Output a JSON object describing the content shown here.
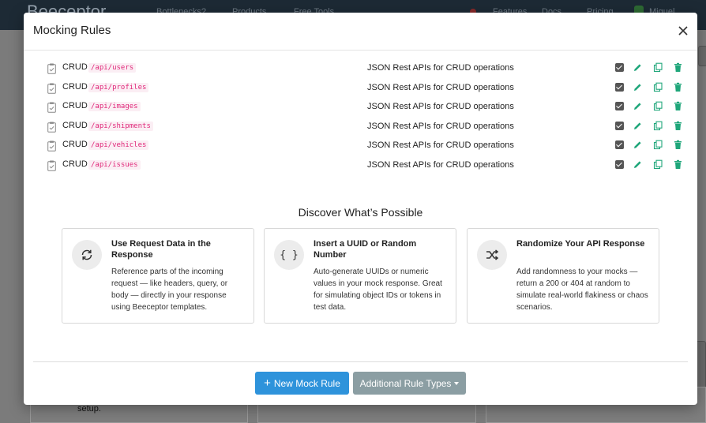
{
  "background": {
    "brand": "Beeceptor",
    "nav": [
      "Bottlenecks?",
      "Products",
      "Free Tools",
      "Features",
      "Docs",
      "Pricing",
      "Miguel"
    ],
    "setup_text": "setup."
  },
  "modal": {
    "title": "Mocking Rules",
    "close_icon": "close-icon"
  },
  "rules": [
    {
      "method": "CRUD",
      "path": "/api/users",
      "description": "JSON Rest APIs for CRUD operations",
      "enabled": true
    },
    {
      "method": "CRUD",
      "path": "/api/profiles",
      "description": "JSON Rest APIs for CRUD operations",
      "enabled": true
    },
    {
      "method": "CRUD",
      "path": "/api/images",
      "description": "JSON Rest APIs for CRUD operations",
      "enabled": true
    },
    {
      "method": "CRUD",
      "path": "/api/shipments",
      "description": "JSON Rest APIs for CRUD operations",
      "enabled": true
    },
    {
      "method": "CRUD",
      "path": "/api/vehicles",
      "description": "JSON Rest APIs for CRUD operations",
      "enabled": true
    },
    {
      "method": "CRUD",
      "path": "/api/issues",
      "description": "JSON Rest APIs for CRUD operations",
      "enabled": true
    }
  ],
  "discover": {
    "title": "Discover What’s Possible",
    "cards": [
      {
        "icon": "refresh-icon",
        "title": "Use Request Data in the Response",
        "description": "Reference parts of the incoming request — like headers, query, or body — directly in your response using Beeceptor templates."
      },
      {
        "icon": "braces-icon",
        "title": "Insert a UUID or Random Number",
        "description": "Auto-generate UUIDs or numeric values in your mock response. Great for simulating object IDs or tokens in test data."
      },
      {
        "icon": "shuffle-icon",
        "title": "Randomize Your API Response",
        "description": "Add randomness to your mocks — return a 200 or 404 at random to simulate real-world flakiness or chaos scenarios."
      }
    ]
  },
  "footer": {
    "new_rule_label": "New Mock Rule",
    "additional_label": "Additional Rule Types"
  },
  "colors": {
    "primary": "#2e93db",
    "secondary": "#8b9ea3",
    "path_text": "#e0297a",
    "action_green": "#1fa67a"
  }
}
